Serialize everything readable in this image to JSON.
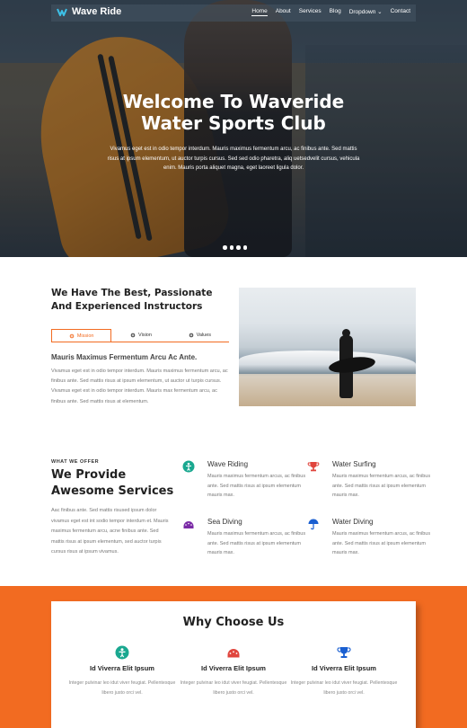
{
  "nav": {
    "logo": "Wave Ride",
    "links": [
      {
        "label": "Home"
      },
      {
        "label": "About"
      },
      {
        "label": "Services"
      },
      {
        "label": "Blog"
      },
      {
        "label": "Dropdown"
      },
      {
        "label": "Contact"
      }
    ]
  },
  "hero": {
    "title_line1": "Welcome To Waveride",
    "title_line2": "Water Sports Club",
    "text": "Vivamus eget est in odio tempor interdum. Mauris maximus fermentum arcu, ac finibus ante. Sed mattis risus at ipsum elementum, ut auctor turpis cursus. Sed sed odio pharetra, aliq uetsedvelit cursus, vehicula enim. Mauris porta aliquet magna, eget laoreet ligula dolor.",
    "slide_count": 4
  },
  "instructors": {
    "title": "We Have The Best, Passionate And Experienced Instructors",
    "tabs": [
      {
        "label": "Mission",
        "icon": "gear-icon"
      },
      {
        "label": "Vision",
        "icon": "gear-icon"
      },
      {
        "label": "Values",
        "icon": "gear-icon"
      }
    ],
    "subtitle": "Mauris Maximus Fermentum Arcu Ac Ante.",
    "text": "Vivamus eget est in odio tempor interdum. Mauris maximus fermentum arcu, ac finibus ante. Sed mattis risus at ipsum elementum, ut auctor ut turpis cursus. Vivamus eget est in odio tempor interdum. Mauris max fermentum arcu, ac finibus ante. Sed mattis risus at elementum."
  },
  "services": {
    "eyebrow": "WHAT WE OFFER",
    "title_line1": "We Provide",
    "title_line2": "Awesome Services",
    "text": "Aac finibus ante. Sed mattis risused ipsum dolor vivamus eget est int sodio tempor interdum et. Mauris maximus fermentum arcu, acne finibus ante. Sed mattis risus at ipsum elementum, sed auctor turpis cursus risus at ipsum vivamus.",
    "items": [
      {
        "title": "Wave Riding",
        "text": "Mauris maximus fermentum arcus, ac finibus ante. Sed mattis risus at ipsum elementum mauris max.",
        "icon": "swimmer-icon",
        "color": "#1aa890"
      },
      {
        "title": "Water Surfing",
        "text": "Mauris maximus fermentum arcus, ac finibus ante. Sed mattis risus at ipsum elementum mauris max.",
        "icon": "trophy-icon",
        "color": "#e0453d"
      },
      {
        "title": "Sea Diving",
        "text": "Mauris maximus fermentum arcus, ac finibus ante. Sed mattis risus at ipsum elementum mauris max.",
        "icon": "gauge-icon",
        "color": "#7a2aa6"
      },
      {
        "title": "Water Diving",
        "text": "Mauris maximus fermentum arcus, ac finibus ante. Sed mattis risus at ipsum elementum mauris max.",
        "icon": "umbrella-icon",
        "color": "#1a5fd1"
      }
    ]
  },
  "why": {
    "title": "Why Choose Us",
    "items": [
      {
        "title": "Id Viverra Elit Ipsum",
        "text": "Integer pulvinar leo idut viver feugiat. Pellentesque libero justo orci vel.",
        "icon": "swimmer-icon",
        "color": "#1aa890"
      },
      {
        "title": "Id Viverra Elit Ipsum",
        "text": "Integer pulvinar leo idut viver feugiat. Pellentesque libero justo orci vel.",
        "icon": "gauge-icon",
        "color": "#e0453d"
      },
      {
        "title": "Id Viverra Elit Ipsum",
        "text": "Integer pulvinar leo idut viver feugiat. Pellentesque libero justo orci vel.",
        "icon": "trophy-icon",
        "color": "#1a5fd1"
      }
    ]
  },
  "colors": {
    "accent": "#f26b21",
    "logo_icon": "#3dc1e8"
  }
}
